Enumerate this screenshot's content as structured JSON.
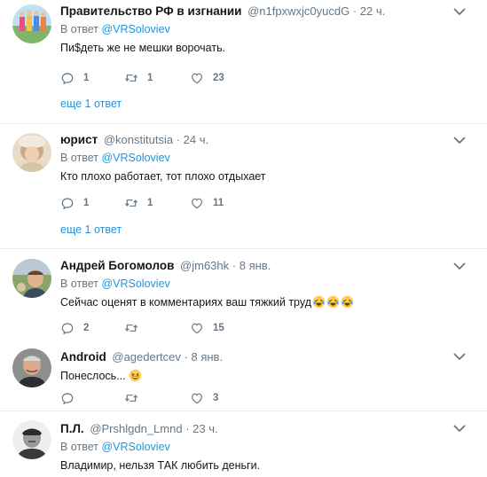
{
  "reply_prefix": "В ответ",
  "tweets": [
    {
      "name": "Правительство РФ в изгнании",
      "handle": "@n1fpxwxjc0yucdG",
      "dot": "·",
      "time": "22 ч.",
      "reply_to": "@VRSoloviev",
      "text": "Пи$деть же не мешки ворочать.",
      "replies": "1",
      "retweets": "1",
      "likes": "23",
      "more": "еще 1 ответ"
    },
    {
      "name": "юрист",
      "handle": "@konstitutsia",
      "dot": "·",
      "time": "24 ч.",
      "reply_to": "@VRSoloviev",
      "text": "Кто плохо работает, тот плохо отдыхает",
      "replies": "1",
      "retweets": "1",
      "likes": "11",
      "more": "еще 1 ответ"
    },
    {
      "name": "Андрей Богомолов",
      "handle": "@jm63hk",
      "dot": "·",
      "time": "8 янв.",
      "reply_to": "@VRSoloviev",
      "text": "Сейчас оценят в комментариях ваш тяжкий труд",
      "replies": "2",
      "retweets": "",
      "likes": "15"
    },
    {
      "name": "Android",
      "handle": "@agedertcev",
      "dot": "·",
      "time": "8 янв.",
      "text": "Понеслось...",
      "replies": "",
      "retweets": "",
      "likes": "3"
    },
    {
      "name": "П.Л.",
      "handle": "@Prshlgdn_Lmnd",
      "dot": "·",
      "time": "23 ч.",
      "reply_to": "@VRSoloviev",
      "text": "Владимир, нельзя ТАК любить деньги."
    }
  ],
  "colors": {
    "link": "#1b95e0",
    "secondary": "#657786",
    "text": "#14171a",
    "separator": "#e6ecf0"
  },
  "icons": {
    "reply": "reply-icon",
    "retweet": "retweet-icon",
    "like": "heart-icon",
    "menu": "chevron-down-icon",
    "laugh": "rolling-on-floor-laughing-emoji",
    "smile": "grinning-squinting-emoji"
  }
}
